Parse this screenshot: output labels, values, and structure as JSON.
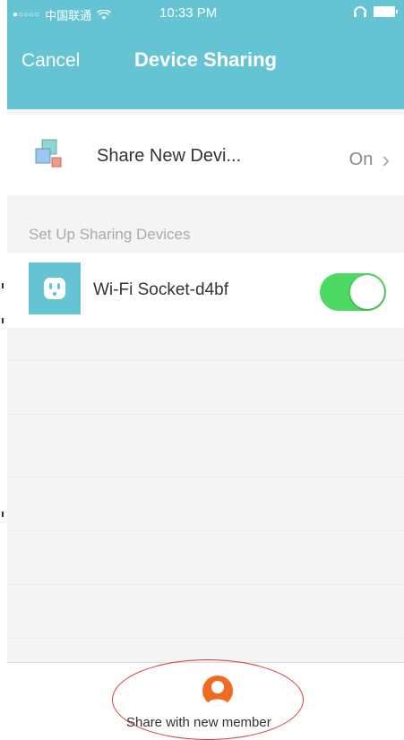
{
  "status_bar": {
    "signal": "●○○○○",
    "carrier": "中国联通",
    "time": "10:33 PM"
  },
  "nav": {
    "cancel_label": "Cancel",
    "title": "Device Sharing"
  },
  "share_new_device": {
    "label": "Share New Devi...",
    "value": "On",
    "chevron": "›"
  },
  "section": {
    "title": "Set Up Sharing Devices"
  },
  "devices": [
    {
      "name": "Wi-Fi Socket-d4bf",
      "enabled": true,
      "icon": "smart-plug-icon"
    }
  ],
  "bottom": {
    "share_label": "Share with new member",
    "icon": "person-icon"
  },
  "colors": {
    "header": "#65c4d4",
    "toggle_on": "#4cd964",
    "member_icon": "#f06b22",
    "annotation": "#d23a3a"
  }
}
